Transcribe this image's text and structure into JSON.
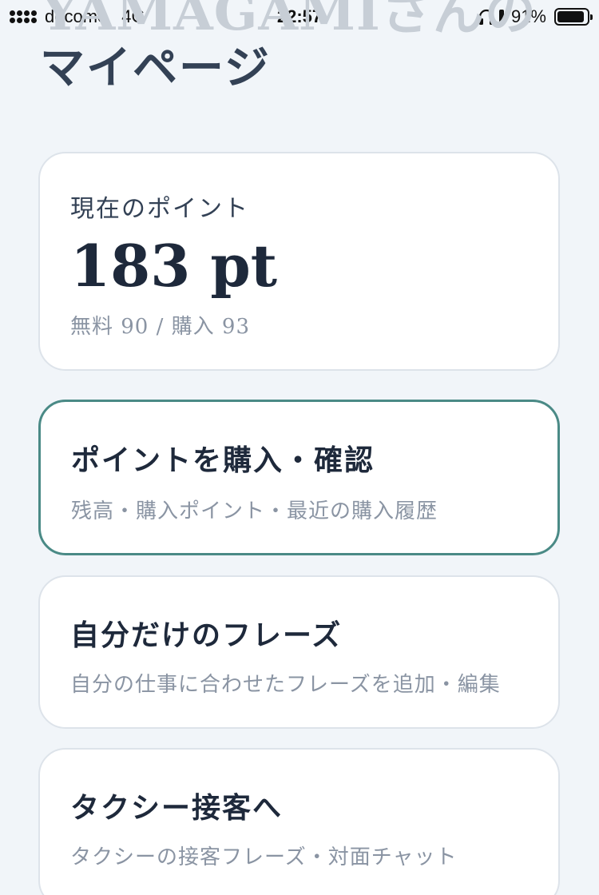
{
  "status_bar": {
    "carrier": "docomo",
    "network": "4G",
    "time": "22:57",
    "battery_percent": "91%",
    "battery_level": 0.91,
    "icons": [
      "signal-icon",
      "headphones-icon",
      "battery-icon"
    ]
  },
  "header": {
    "ghost_title": "YAMAGAMIさんの",
    "title": "マイページ"
  },
  "points": {
    "label": "現在のポイント",
    "value": "183 pt",
    "breakdown": "無料 90 / 購入 93"
  },
  "menu": [
    {
      "title": "ポイントを購入・確認",
      "subtitle": "残高・購入ポイント・最近の購入履歴"
    },
    {
      "title": "自分だけのフレーズ",
      "subtitle": "自分の仕事に合わせたフレーズを追加・編集"
    },
    {
      "title": "タクシー接客へ",
      "subtitle": "タクシーの接客フレーズ・対面チャット"
    }
  ],
  "colors": {
    "background": "#f1f5f9",
    "card": "#ffffff",
    "selected_border": "#4a8a86",
    "text_primary": "#1e293b",
    "text_secondary": "#8a94a3"
  }
}
